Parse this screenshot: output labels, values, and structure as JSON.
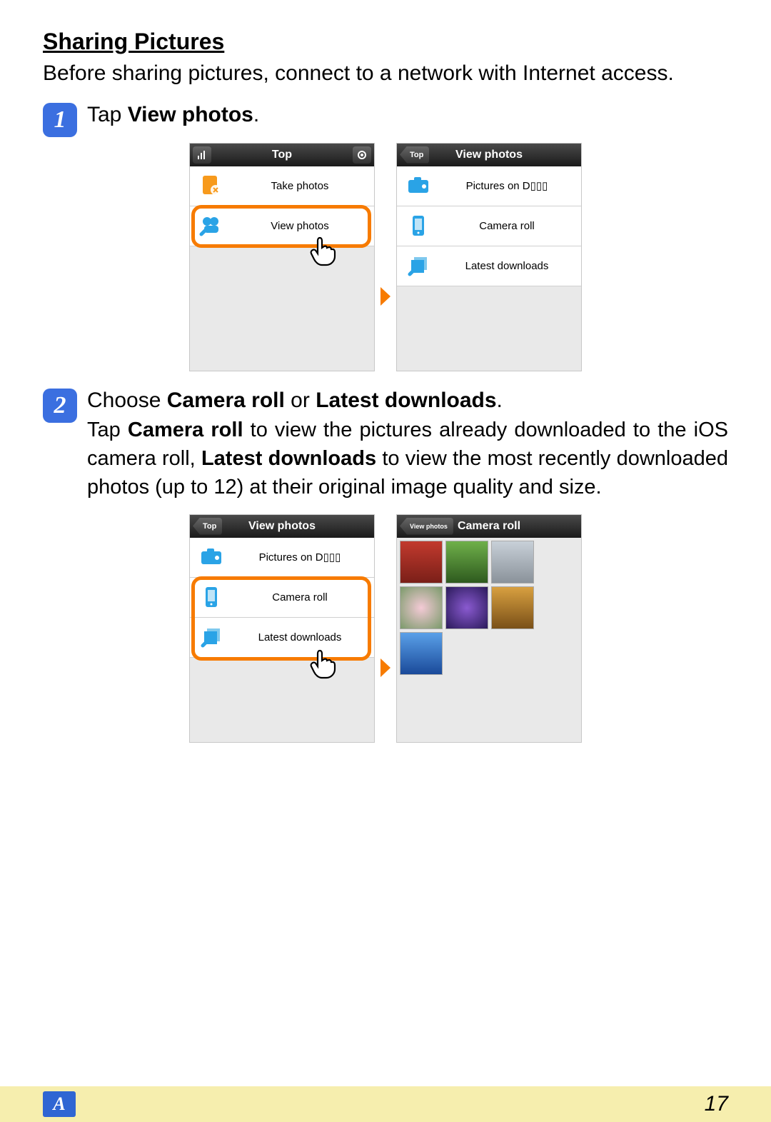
{
  "section_title": "Sharing Pictures",
  "intro": "Before sharing pictures, connect to a network with Internet access.",
  "steps": {
    "s1": {
      "num": "1",
      "title_pre": "Tap ",
      "title_bold": "View photos",
      "title_post": "."
    },
    "s2": {
      "num": "2",
      "title_pre": "Choose ",
      "title_bold1": "Camera roll",
      "title_mid": " or ",
      "title_bold2": "Latest downloads",
      "title_post": ".",
      "body_1": "Tap ",
      "body_b1": "Camera roll",
      "body_2": " to view the pictures already downloaded to the iOS camera roll, ",
      "body_b2": "Latest downloads",
      "body_3": " to view the most recently downloaded photos (up to 12) at their original image quality and size."
    }
  },
  "screens": {
    "top_left": {
      "header_title": "Top",
      "left_icon": "signal-icon",
      "right_icon": "gear-icon",
      "rows": [
        {
          "icon": "take-photos-icon",
          "label": "Take photos"
        },
        {
          "icon": "view-photos-icon",
          "label": "View photos"
        }
      ]
    },
    "top_right": {
      "back_label": "Top",
      "header_title": "View photos",
      "rows": [
        {
          "icon": "camera-icon",
          "label": "Pictures on D▯▯▯"
        },
        {
          "icon": "phone-icon",
          "label": "Camera roll"
        },
        {
          "icon": "stack-icon",
          "label": "Latest downloads"
        }
      ]
    },
    "bottom_left": {
      "back_label": "Top",
      "header_title": "View photos",
      "rows": [
        {
          "icon": "camera-icon",
          "label": "Pictures on D▯▯▯"
        },
        {
          "icon": "phone-icon",
          "label": "Camera roll"
        },
        {
          "icon": "stack-icon",
          "label": "Latest downloads"
        }
      ]
    },
    "bottom_right": {
      "back_label": "View photos",
      "header_title": "Camera roll",
      "thumbs": [
        "#c23a2e",
        "#3b7a2e",
        "#b8c0c8",
        "#d8a0b0",
        "#5a3a8a",
        "#b88820",
        "#2a6ad0"
      ]
    }
  },
  "footer": {
    "badge": "A",
    "page": "17"
  }
}
